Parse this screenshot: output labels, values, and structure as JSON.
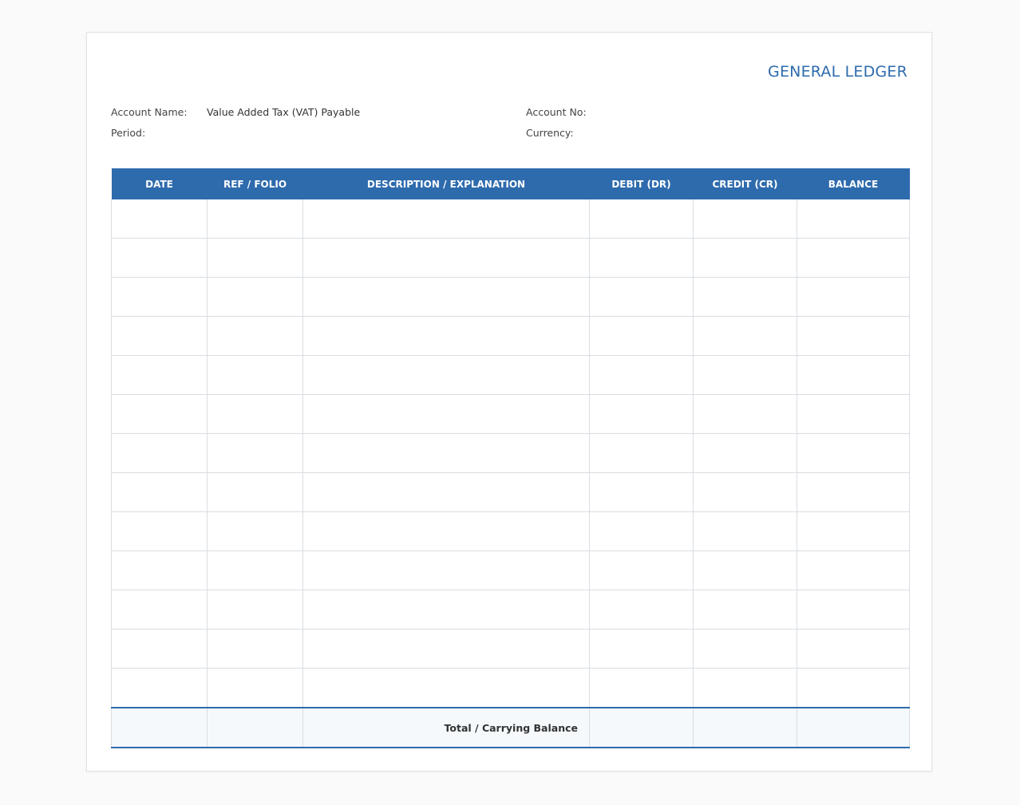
{
  "document": {
    "title": "GENERAL LEDGER"
  },
  "fields": {
    "account_name": {
      "label": "Account Name:",
      "value": "Value Added Tax (VAT) Payable"
    },
    "period": {
      "label": "Period:",
      "value": ""
    },
    "account_no": {
      "label": "Account No:",
      "value": ""
    },
    "currency": {
      "label": "Currency:",
      "value": ""
    }
  },
  "table": {
    "columns": [
      "DATE",
      "REF / FOLIO",
      "DESCRIPTION / EXPLANATION",
      "DEBIT (DR)",
      "CREDIT (CR)",
      "BALANCE"
    ],
    "rows": [
      [
        "",
        "",
        "",
        "",
        "",
        ""
      ],
      [
        "",
        "",
        "",
        "",
        "",
        ""
      ],
      [
        "",
        "",
        "",
        "",
        "",
        ""
      ],
      [
        "",
        "",
        "",
        "",
        "",
        ""
      ],
      [
        "",
        "",
        "",
        "",
        "",
        ""
      ],
      [
        "",
        "",
        "",
        "",
        "",
        ""
      ],
      [
        "",
        "",
        "",
        "",
        "",
        ""
      ],
      [
        "",
        "",
        "",
        "",
        "",
        ""
      ],
      [
        "",
        "",
        "",
        "",
        "",
        ""
      ],
      [
        "",
        "",
        "",
        "",
        "",
        ""
      ],
      [
        "",
        "",
        "",
        "",
        "",
        ""
      ],
      [
        "",
        "",
        "",
        "",
        "",
        ""
      ],
      [
        "",
        "",
        "",
        "",
        "",
        ""
      ]
    ],
    "footer": {
      "label": "Total / Carrying Balance",
      "debit": "",
      "credit": "",
      "balance": ""
    }
  },
  "colors": {
    "accent": "#2e6bad",
    "grid": "#d9dde2",
    "footer_bg": "#f5f9fc"
  }
}
